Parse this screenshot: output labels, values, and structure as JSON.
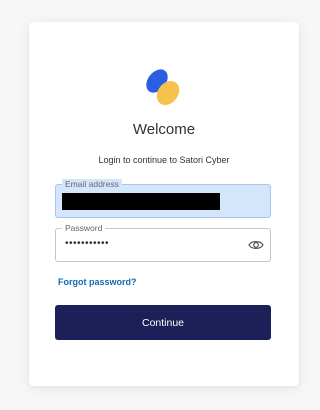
{
  "header": {
    "logo_icon": "satori-logo",
    "title": "Welcome",
    "subtitle": "Login to continue to Satori Cyber"
  },
  "form": {
    "email": {
      "label": "Email address",
      "value_redacted": true
    },
    "password": {
      "label": "Password",
      "value_masked": "•••••••••••",
      "toggle_icon": "eye-icon"
    },
    "forgot_password_label": "Forgot password?",
    "continue_label": "Continue"
  },
  "colors": {
    "primary_button": "#1d2058",
    "link": "#0f6bb4",
    "logo_blue": "#2b5fe3",
    "logo_yellow": "#f5c34b",
    "email_field_bg": "#d3e6fb"
  }
}
